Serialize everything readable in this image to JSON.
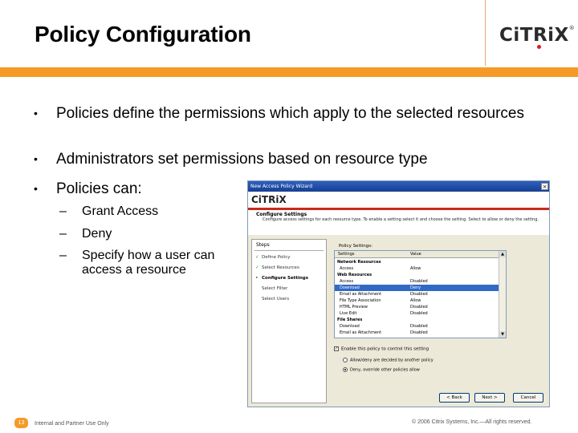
{
  "slide": {
    "title": "Policy Configuration",
    "logo_text": "CiTRiX",
    "logo_reg": "®"
  },
  "bullets": [
    "Policies define the permissions which apply to the selected resources",
    "Administrators set permissions based on resource type",
    "Policies can:"
  ],
  "sub_bullets": [
    "Grant Access",
    "Deny",
    "Specify how a user can access a resource"
  ],
  "markers": {
    "bullet": "•",
    "dash": "–"
  },
  "dialog": {
    "title": "New Access Policy Wizard",
    "close": "×",
    "logo": "CiTRiX",
    "heading": "Configure Settings",
    "description": "Configure access settings for each resource type. To enable a setting select it and choose the setting. Select to allow or deny the setting.",
    "steps_title": "Steps",
    "steps": [
      {
        "label": "Define Policy",
        "check": "✓"
      },
      {
        "label": "Select Resources",
        "check": "✓"
      },
      {
        "label": "Configure Settings",
        "check": "•"
      },
      {
        "label": "Select Filter",
        "check": ""
      },
      {
        "label": "Select Users",
        "check": ""
      }
    ],
    "policy_settings_label": "Policy Settings:",
    "columns": [
      "Settings",
      "Value"
    ],
    "rows": [
      {
        "setting": "Network Resources",
        "value": "",
        "category": true
      },
      {
        "setting": "Access",
        "value": "Allow"
      },
      {
        "setting": "Web Resources",
        "value": "",
        "category": true
      },
      {
        "setting": "Access",
        "value": "Disabled"
      },
      {
        "setting": "Download",
        "value": "Deny",
        "selected": true
      },
      {
        "setting": "Email as Attachment",
        "value": "Disabled"
      },
      {
        "setting": "File Type Association",
        "value": "Allow"
      },
      {
        "setting": "HTML Preview",
        "value": "Disabled"
      },
      {
        "setting": "Live Edit",
        "value": "Disabled"
      },
      {
        "setting": "File Shares",
        "value": "",
        "category": true
      },
      {
        "setting": "Download",
        "value": "Disabled"
      },
      {
        "setting": "Email as Attachment",
        "value": "Disabled"
      }
    ],
    "enable_label": "Enable this policy to control this setting",
    "enable_checked": "✓",
    "radio_options": [
      {
        "label": "Allow/deny are decided by another policy",
        "selected": false
      },
      {
        "label": "Deny, override other policies allow",
        "selected": true
      }
    ],
    "scroll_up": "▲",
    "scroll_down": "▼",
    "buttons": {
      "back": "< Back",
      "next": "Next >",
      "cancel": "Cancel"
    }
  },
  "footer": {
    "page_number": "13",
    "left": "Internal and Partner Use Only",
    "right": "© 2006 Citrix Systems, Inc.—All rights reserved."
  },
  "colors": {
    "accent_orange": "#f59a28",
    "citrix_red": "#d4201f",
    "xp_blue": "#316ac5"
  }
}
